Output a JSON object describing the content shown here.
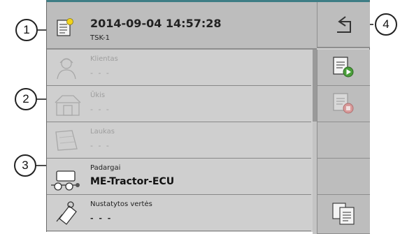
{
  "header": {
    "title": "2014-09-04 14:57:28",
    "subtitle": "TSK-1"
  },
  "rows": [
    {
      "label": "Klientas",
      "value": "- - -",
      "icon": "farmer-icon",
      "state": "disabled"
    },
    {
      "label": "Ūkis",
      "value": "- - -",
      "icon": "farm-icon",
      "state": "disabled"
    },
    {
      "label": "Laukas",
      "value": "- - -",
      "icon": "field-icon",
      "state": "disabled"
    },
    {
      "label": "Padargai",
      "value": "ME-Tractor-ECU",
      "icon": "implement-icon",
      "state": "active"
    },
    {
      "label": "Nustatytos vertės",
      "value": "- - -",
      "icon": "setpoint-icon",
      "state": "enabled"
    }
  ],
  "side_buttons": [
    {
      "name": "start-task-button",
      "icon": "task-start-icon"
    },
    {
      "name": "stop-task-button",
      "icon": "task-stop-icon"
    },
    {
      "name": "empty-button-3",
      "icon": ""
    },
    {
      "name": "empty-button-4",
      "icon": ""
    },
    {
      "name": "task-list-button",
      "icon": "task-list-icon"
    }
  ],
  "callouts": [
    "1",
    "2",
    "3",
    "4"
  ]
}
